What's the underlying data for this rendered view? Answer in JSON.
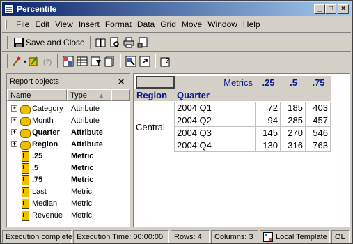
{
  "window": {
    "title": "Percentile"
  },
  "menu": [
    "File",
    "Edit",
    "View",
    "Insert",
    "Format",
    "Data",
    "Grid",
    "Move",
    "Window",
    "Help"
  ],
  "toolbar": {
    "save_label": "Save and Close"
  },
  "report_objects": {
    "title": "Report objects",
    "columns": [
      "Name",
      "Type"
    ],
    "items": [
      {
        "name": "Category",
        "type": "Attribute",
        "kind": "attribute",
        "bold": false
      },
      {
        "name": "Month",
        "type": "Attribute",
        "kind": "attribute",
        "bold": false
      },
      {
        "name": "Quarter",
        "type": "Attribute",
        "kind": "attribute",
        "bold": true
      },
      {
        "name": "Region",
        "type": "Attribute",
        "kind": "attribute",
        "bold": true
      },
      {
        "name": ".25",
        "type": "Metric",
        "kind": "metric",
        "bold": true
      },
      {
        "name": ".5",
        "type": "Metric",
        "kind": "metric",
        "bold": true
      },
      {
        "name": ".75",
        "type": "Metric",
        "kind": "metric",
        "bold": true
      },
      {
        "name": "Last",
        "type": "Metric",
        "kind": "metric",
        "bold": false
      },
      {
        "name": "Median",
        "type": "Metric",
        "kind": "metric",
        "bold": false
      },
      {
        "name": "Revenue",
        "type": "Metric",
        "kind": "metric",
        "bold": false
      }
    ]
  },
  "grid": {
    "metrics_label": "Metrics",
    "metric_headers": [
      ".25",
      ".5",
      ".75"
    ],
    "row_headers": [
      "Region",
      "Quarter"
    ],
    "region": "Central",
    "rows": [
      {
        "quarter": "2004 Q1",
        "values": [
          "72",
          "185",
          "403"
        ]
      },
      {
        "quarter": "2004 Q2",
        "values": [
          "94",
          "285",
          "457"
        ]
      },
      {
        "quarter": "2004 Q3",
        "values": [
          "145",
          "270",
          "546"
        ]
      },
      {
        "quarter": "2004 Q4",
        "values": [
          "130",
          "316",
          "763"
        ]
      }
    ]
  },
  "status": {
    "execution": "Execution complete",
    "time": "Execution Time: 00:00:00",
    "rows": "Rows: 4",
    "columns": "Columns: 3",
    "template": "Local Template",
    "mode": "OL"
  }
}
